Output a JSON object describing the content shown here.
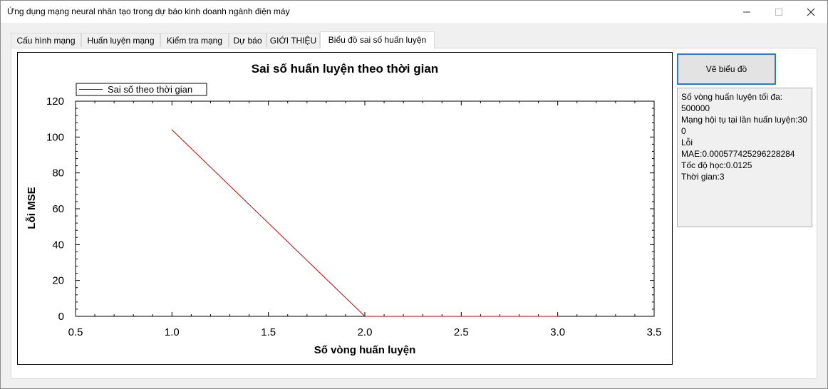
{
  "window": {
    "title": "Ứng dụng mạng neural nhân tạo trong dự báo kinh doanh ngành điện máy"
  },
  "tabs": [
    {
      "label": "Cấu hình mạng"
    },
    {
      "label": "Huấn luyện mạng"
    },
    {
      "label": "Kiểm tra mạng"
    },
    {
      "label": "Dự báo"
    },
    {
      "label": "GIỚI THIỆU"
    },
    {
      "label": "Biểu đồ sai số huấn luyện",
      "active": true
    }
  ],
  "draw_button": {
    "label": "Vẽ biểu đồ"
  },
  "info": {
    "lines": [
      "Số vòng huấn luyện tối đa:",
      "500000",
      "Mạng hội tụ tại lần huấn luyện:300",
      "Lỗi",
      "MAE:0.000577425296228284",
      "Tốc độ học:0.0125",
      "Thời gian:3"
    ]
  },
  "chart_data": {
    "type": "line",
    "title": "Sai số huấn luyện theo thời gian",
    "xlabel": "Số vòng huấn luyện",
    "ylabel": "Lỗi MSE",
    "xlim": [
      0.5,
      3.5
    ],
    "ylim": [
      0,
      120
    ],
    "xticks": [
      "0.5",
      "1.0",
      "1.5",
      "2.0",
      "2.5",
      "3.0",
      "3.5"
    ],
    "yticks": [
      "0",
      "20",
      "40",
      "60",
      "80",
      "100",
      "120"
    ],
    "legend_position": "top-left",
    "grid": false,
    "series": [
      {
        "name": "Sai số theo thời gian",
        "color": "#c00000",
        "x": [
          1.0,
          2.0,
          3.0
        ],
        "y": [
          104,
          0,
          0
        ]
      }
    ]
  },
  "icons": {
    "minimize": "minimize-icon",
    "maximize": "maximize-icon",
    "close": "close-icon"
  }
}
